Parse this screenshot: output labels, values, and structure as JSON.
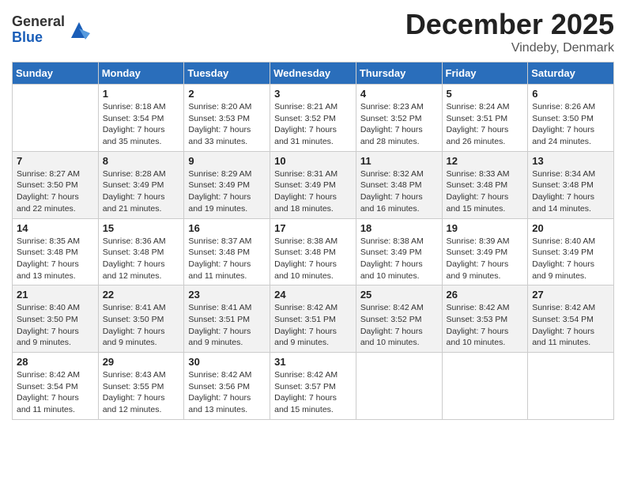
{
  "logo": {
    "general": "General",
    "blue": "Blue"
  },
  "title": "December 2025",
  "subtitle": "Vindeby, Denmark",
  "headers": [
    "Sunday",
    "Monday",
    "Tuesday",
    "Wednesday",
    "Thursday",
    "Friday",
    "Saturday"
  ],
  "weeks": [
    [
      {
        "day": "",
        "info": ""
      },
      {
        "day": "1",
        "info": "Sunrise: 8:18 AM\nSunset: 3:54 PM\nDaylight: 7 hours\nand 35 minutes."
      },
      {
        "day": "2",
        "info": "Sunrise: 8:20 AM\nSunset: 3:53 PM\nDaylight: 7 hours\nand 33 minutes."
      },
      {
        "day": "3",
        "info": "Sunrise: 8:21 AM\nSunset: 3:52 PM\nDaylight: 7 hours\nand 31 minutes."
      },
      {
        "day": "4",
        "info": "Sunrise: 8:23 AM\nSunset: 3:52 PM\nDaylight: 7 hours\nand 28 minutes."
      },
      {
        "day": "5",
        "info": "Sunrise: 8:24 AM\nSunset: 3:51 PM\nDaylight: 7 hours\nand 26 minutes."
      },
      {
        "day": "6",
        "info": "Sunrise: 8:26 AM\nSunset: 3:50 PM\nDaylight: 7 hours\nand 24 minutes."
      }
    ],
    [
      {
        "day": "7",
        "info": "Sunrise: 8:27 AM\nSunset: 3:50 PM\nDaylight: 7 hours\nand 22 minutes."
      },
      {
        "day": "8",
        "info": "Sunrise: 8:28 AM\nSunset: 3:49 PM\nDaylight: 7 hours\nand 21 minutes."
      },
      {
        "day": "9",
        "info": "Sunrise: 8:29 AM\nSunset: 3:49 PM\nDaylight: 7 hours\nand 19 minutes."
      },
      {
        "day": "10",
        "info": "Sunrise: 8:31 AM\nSunset: 3:49 PM\nDaylight: 7 hours\nand 18 minutes."
      },
      {
        "day": "11",
        "info": "Sunrise: 8:32 AM\nSunset: 3:48 PM\nDaylight: 7 hours\nand 16 minutes."
      },
      {
        "day": "12",
        "info": "Sunrise: 8:33 AM\nSunset: 3:48 PM\nDaylight: 7 hours\nand 15 minutes."
      },
      {
        "day": "13",
        "info": "Sunrise: 8:34 AM\nSunset: 3:48 PM\nDaylight: 7 hours\nand 14 minutes."
      }
    ],
    [
      {
        "day": "14",
        "info": "Sunrise: 8:35 AM\nSunset: 3:48 PM\nDaylight: 7 hours\nand 13 minutes."
      },
      {
        "day": "15",
        "info": "Sunrise: 8:36 AM\nSunset: 3:48 PM\nDaylight: 7 hours\nand 12 minutes."
      },
      {
        "day": "16",
        "info": "Sunrise: 8:37 AM\nSunset: 3:48 PM\nDaylight: 7 hours\nand 11 minutes."
      },
      {
        "day": "17",
        "info": "Sunrise: 8:38 AM\nSunset: 3:48 PM\nDaylight: 7 hours\nand 10 minutes."
      },
      {
        "day": "18",
        "info": "Sunrise: 8:38 AM\nSunset: 3:49 PM\nDaylight: 7 hours\nand 10 minutes."
      },
      {
        "day": "19",
        "info": "Sunrise: 8:39 AM\nSunset: 3:49 PM\nDaylight: 7 hours\nand 9 minutes."
      },
      {
        "day": "20",
        "info": "Sunrise: 8:40 AM\nSunset: 3:49 PM\nDaylight: 7 hours\nand 9 minutes."
      }
    ],
    [
      {
        "day": "21",
        "info": "Sunrise: 8:40 AM\nSunset: 3:50 PM\nDaylight: 7 hours\nand 9 minutes."
      },
      {
        "day": "22",
        "info": "Sunrise: 8:41 AM\nSunset: 3:50 PM\nDaylight: 7 hours\nand 9 minutes."
      },
      {
        "day": "23",
        "info": "Sunrise: 8:41 AM\nSunset: 3:51 PM\nDaylight: 7 hours\nand 9 minutes."
      },
      {
        "day": "24",
        "info": "Sunrise: 8:42 AM\nSunset: 3:51 PM\nDaylight: 7 hours\nand 9 minutes."
      },
      {
        "day": "25",
        "info": "Sunrise: 8:42 AM\nSunset: 3:52 PM\nDaylight: 7 hours\nand 10 minutes."
      },
      {
        "day": "26",
        "info": "Sunrise: 8:42 AM\nSunset: 3:53 PM\nDaylight: 7 hours\nand 10 minutes."
      },
      {
        "day": "27",
        "info": "Sunrise: 8:42 AM\nSunset: 3:54 PM\nDaylight: 7 hours\nand 11 minutes."
      }
    ],
    [
      {
        "day": "28",
        "info": "Sunrise: 8:42 AM\nSunset: 3:54 PM\nDaylight: 7 hours\nand 11 minutes."
      },
      {
        "day": "29",
        "info": "Sunrise: 8:43 AM\nSunset: 3:55 PM\nDaylight: 7 hours\nand 12 minutes."
      },
      {
        "day": "30",
        "info": "Sunrise: 8:42 AM\nSunset: 3:56 PM\nDaylight: 7 hours\nand 13 minutes."
      },
      {
        "day": "31",
        "info": "Sunrise: 8:42 AM\nSunset: 3:57 PM\nDaylight: 7 hours\nand 15 minutes."
      },
      {
        "day": "",
        "info": ""
      },
      {
        "day": "",
        "info": ""
      },
      {
        "day": "",
        "info": ""
      }
    ]
  ]
}
